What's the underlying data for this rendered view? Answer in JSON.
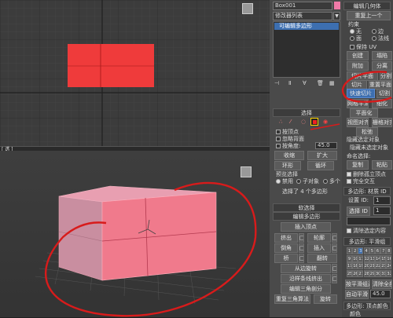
{
  "viewports": {
    "top_label": "",
    "persp_label": "[ 透 ]"
  },
  "modify_panel": {
    "object_name": "Box001",
    "modifier_list": "修改器列表",
    "stack_item": "可编辑多边形",
    "selection": {
      "header": "选择",
      "by_vertex": "按顶点",
      "ignore_backfacing": "忽略背面",
      "by_angle": "按角度:",
      "by_angle_value": "45.0",
      "shrink": "收缩",
      "grow": "扩大",
      "ring": "环形",
      "loop": "循环",
      "preview_label": "预览选择",
      "preview_off": "禁用",
      "preview_subobj": "子对象",
      "preview_multi": "多个",
      "status": "选择了 4 个多边形"
    },
    "soft_selection_header": "软选择",
    "edit_polygons": {
      "header": "编辑多边形",
      "insert_vertex": "插入顶点",
      "extrude": "挤出",
      "outline": "轮廓",
      "bevel": "倒角",
      "inset": "插入",
      "bridge": "桥",
      "flip": "翻转",
      "hinge": "从边旋转",
      "extrude_spline": "沿样条线挤出",
      "edit_tri": "编辑三角剖分",
      "retriangulate": "重复三角算法",
      "turn": "旋转"
    }
  },
  "right_panel": {
    "title": "编辑几何体",
    "repeat_last": "重复上一个",
    "constraints": "约束",
    "none": "无",
    "edge": "边",
    "face": "面",
    "normal": "法线",
    "preserve_uvs": "保持 UV",
    "create": "创建",
    "collapse": "塌陷",
    "attach": "附加",
    "detach": "分离",
    "slice_plane": "切片平面",
    "split": "分割",
    "slice": "切片",
    "reset_plane": "重置平面",
    "quickslice": "快速切片",
    "cut": "切割",
    "meshsmooth": "网格平滑",
    "tessellate": "细化",
    "planarize": "平面化",
    "view_align": "视图对齐",
    "grid_align": "栅格对齐",
    "relax": "松弛",
    "hide_selected": "隐藏选定对象",
    "unhide_all": "全部取消隐藏",
    "hide_unselected": "隐藏未选定对象",
    "named_selections": "命名选择:",
    "copy": "复制",
    "paste": "粘贴",
    "delete_isolated": "删除孤立顶点",
    "full_interactivity": "完全交互",
    "poly_material_header": "多边形: 材质 ID",
    "set_id": "设置 ID:",
    "set_id_value": "1",
    "select_id": "选择 ID",
    "select_id_value": "1",
    "clear_selection": "清除选定内容",
    "smoothing_header": "多边形: 平滑组",
    "smoothing_groups": [
      "1",
      "2",
      "3",
      "4",
      "5",
      "6",
      "7",
      "8",
      "9",
      "10",
      "11",
      "12",
      "13",
      "14",
      "15",
      "16",
      "17",
      "18",
      "19",
      "20",
      "21",
      "22",
      "23",
      "24",
      "25",
      "26",
      "27",
      "28",
      "29",
      "30",
      "31",
      "32"
    ],
    "select_by_sg": "按平滑组选择",
    "clear_all": "清除全部",
    "auto_smooth": "自动平滑",
    "auto_smooth_value": "45.0",
    "vertex_colors_header": "多边形: 顶点颜色",
    "color_label": "颜色"
  },
  "colors": {
    "accent_blue": "#3d6fb0",
    "object_red": "#ef3b3b",
    "selected_pink": "#f07a8c",
    "annotation_red": "#d81b1b"
  }
}
